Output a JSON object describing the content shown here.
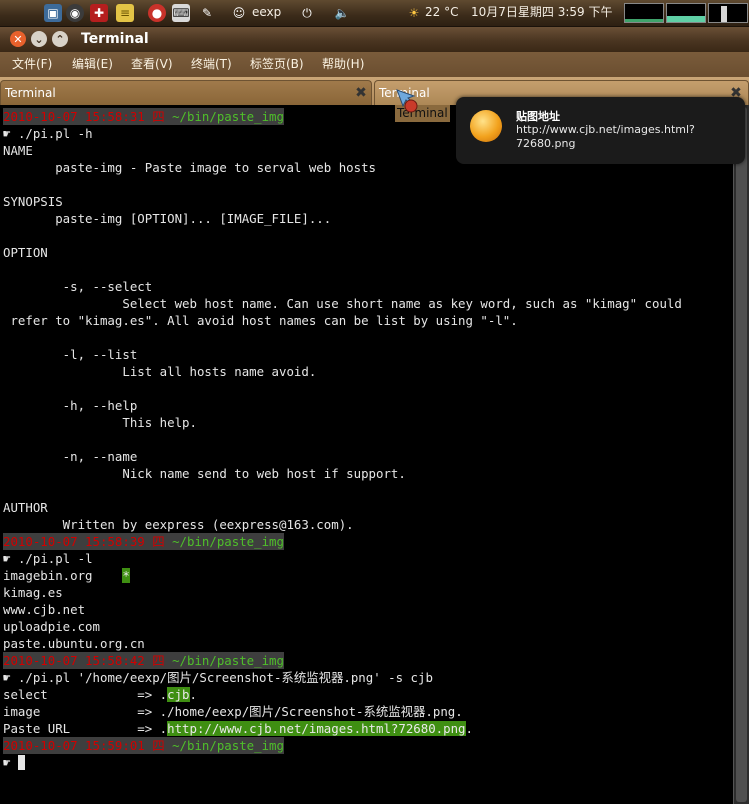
{
  "panel": {
    "user": "eexp",
    "weather": "22 °C",
    "clock": "10月7日星期四  3:59 下午"
  },
  "window": {
    "title": "Terminal",
    "menus": [
      "文件(F)",
      "编辑(E)",
      "查看(V)",
      "终端(T)",
      "标签页(B)",
      "帮助(H)"
    ],
    "tabs": [
      "Terminal",
      "Terminal"
    ],
    "drag_label": "Terminal"
  },
  "notification": {
    "title": "贴图地址",
    "body": "http://www.cjb.net/images.html?\n72680.png"
  },
  "terminal": {
    "prompts": [
      {
        "date": "2010-10-07 15:58:31 四",
        "path": "~/bin/paste_img"
      },
      {
        "date": "2010-10-07 15:58:39 四",
        "path": "~/bin/paste_img"
      },
      {
        "date": "2010-10-07 15:58:42 四",
        "path": "~/bin/paste_img"
      },
      {
        "date": "2010-10-07 15:59:01 四",
        "path": "~/bin/paste_img"
      }
    ],
    "prompt_glyph": "☛",
    "cmd1": "./pi.pl -h",
    "help": {
      "l1": "NAME",
      "l2": "       paste-img - Paste image to serval web hosts",
      "l3": "SYNOPSIS",
      "l4": "       paste-img [OPTION]... [IMAGE_FILE]...",
      "l5": "OPTION",
      "l6": "        -s, --select",
      "l7": "                Select web host name. Can use short name as key word, such as \"kimag\" could",
      "l8": " refer to \"kimag.es\". All avoid host names can be list by using \"-l\".",
      "l9": "        -l, --list",
      "l10": "                List all hosts name avoid.",
      "l11": "        -h, --help",
      "l12": "                This help.",
      "l13": "        -n, --name",
      "l14": "                Nick name send to web host if support.",
      "l15": "AUTHOR",
      "l16": "        Written by eexpress (eexpress@163.com)."
    },
    "cmd2": "./pi.pl -l",
    "hosts": [
      "imagebin.org",
      "kimag.es",
      "www.cjb.net",
      "uploadpie.com",
      "paste.ubuntu.org.cn"
    ],
    "host_marker": "*",
    "cmd3": "./pi.pl '/home/eexp/图片/Screenshot-系统监视器.png' -s cjb",
    "out": {
      "select_label": "select            => .",
      "select_value": "cjb",
      "select_end": ".",
      "image_label": "image             => ./home/eexp/图片/Screenshot-系统监视器.png.",
      "url_label": "Paste URL         => .",
      "url_value": "http://www.cjb.net/images.html?72680.png",
      "url_end": "."
    }
  },
  "colors": {
    "prompt_date": "#d10000",
    "prompt_path": "#4fbf2a",
    "highlight": "#3f8f12",
    "panel": "#3b2b1a",
    "tabbar": "#b08b5b"
  }
}
